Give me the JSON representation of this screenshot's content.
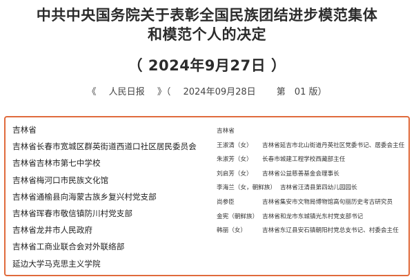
{
  "title": {
    "line1": "中共中央国务院关于表彰全国民族团结进步模范集体",
    "line2": "和模范个人的决定",
    "date": "（ 2024年9月27日 ）"
  },
  "source": {
    "open": "《",
    "paper": "人民日报",
    "close": "》（",
    "date": "2024年09月28日",
    "edition": "第　01 版）"
  },
  "collectives": [
    "吉林省",
    "吉林省长春市宽城区群英街道西道口社区居民委员会",
    "吉林省吉林市第七中学校",
    "吉林省梅河口市民族文化馆",
    "吉林省通榆县向海蒙古族乡复兴村党支部",
    "吉林省珲春市敬信镇防川村党支部",
    "吉林省龙井市人民政府",
    "吉林省工商业联合会对外联络部",
    "延边大学马克思主义学院"
  ],
  "individuals": {
    "header": "吉林省",
    "rows": [
      {
        "name": "王淑清（女）",
        "role": "吉林省延吉市北山街道丹英社区党委书记、居委会主任"
      },
      {
        "name": "朱淑芳（女）",
        "role": "长春市城建工程学校西藏部主任"
      },
      {
        "name": "刘启芳（女）",
        "role": "吉林省公益慈善基金会理事长"
      },
      {
        "name": "李海兰（女，朝鲜族）",
        "role": "吉林省汪清县第四幼儿园园长"
      },
      {
        "name": "尚参臣",
        "role": "吉林省集安市文物局博物馆高句丽历史考古研究员"
      },
      {
        "name": "金宪（朝鲜族）",
        "role": "吉林省和龙市东城镇光东村党支部书记"
      },
      {
        "name": "韩丽（女）",
        "role": "吉林省东辽县安石镇朝阳村党总支书记、村委会主任"
      }
    ]
  }
}
